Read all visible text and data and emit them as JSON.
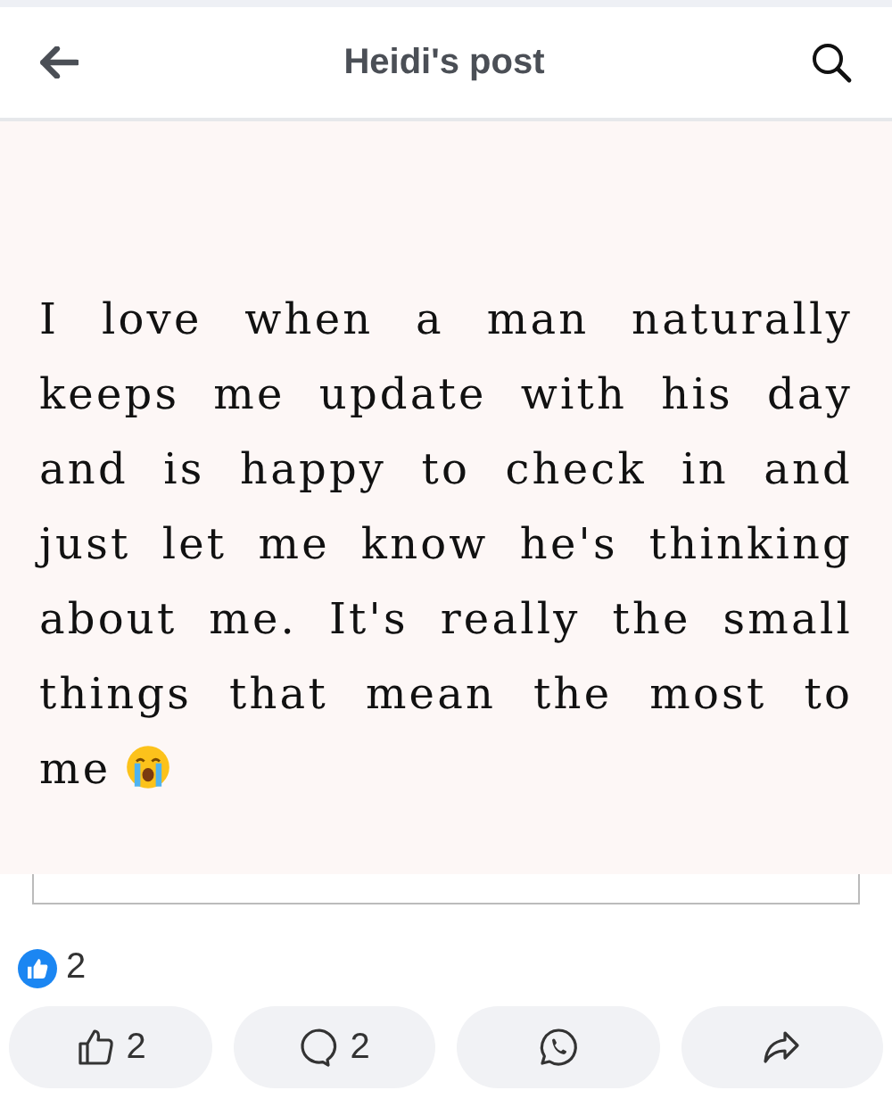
{
  "header": {
    "title": "Heidi's post"
  },
  "post": {
    "text": "I love when a man naturally keeps me update with his day and is happy to check in and just let me know he's thinking about me. It's really the small things that mean the most to me"
  },
  "reactions": {
    "count": "2"
  },
  "actions": [
    {
      "kind": "like",
      "count": "2"
    },
    {
      "kind": "comment",
      "count": "2"
    },
    {
      "kind": "whatsapp"
    },
    {
      "kind": "share"
    }
  ]
}
